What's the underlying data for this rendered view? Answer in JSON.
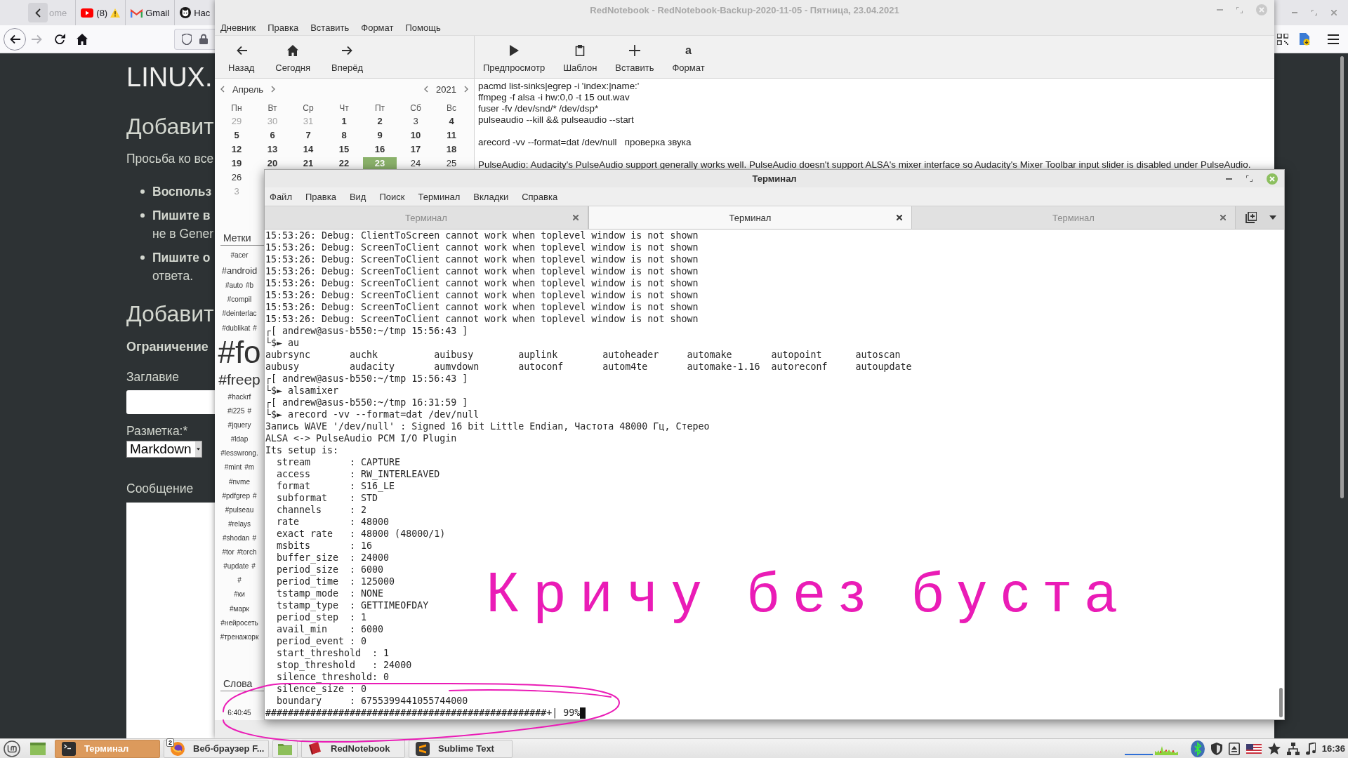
{
  "browser": {
    "tabs": [
      {
        "kind": "plain",
        "label": "ome",
        "alert": false
      },
      {
        "kind": "video",
        "label": "(8)",
        "alert": true
      },
      {
        "kind": "mail",
        "label": "Gmail",
        "alert": false
      },
      {
        "kind": "repo",
        "label": "Нас",
        "alert": false
      }
    ],
    "nav": [
      {
        "kind": "back",
        "disabled": false
      },
      {
        "kind": "forward",
        "disabled": true
      },
      {
        "kind": "reload",
        "disabled": false
      },
      {
        "kind": "home",
        "disabled": false
      }
    ],
    "page": {
      "site_title": "LINUX.",
      "blocks": [
        {
          "kind": "heading",
          "text": "Добавит"
        },
        {
          "kind": "paragraph",
          "text": "Просьба ко все"
        },
        {
          "kind": "bullets",
          "items": [
            {
              "lead": "Воспольз"
            },
            {
              "lead": "Пишите в",
              "rest": "не в Gener"
            },
            {
              "lead": "Пишите о",
              "rest": "ответа."
            }
          ]
        },
        {
          "kind": "heading",
          "text": "Добавит"
        },
        {
          "kind": "subheading",
          "text": "Ограничение"
        },
        {
          "kind": "label",
          "text": "Заглавие"
        },
        {
          "kind": "input"
        },
        {
          "kind": "label",
          "text": "Разметка:*"
        },
        {
          "kind": "select",
          "value": "Markdown"
        },
        {
          "kind": "label",
          "text": "Сообщение"
        },
        {
          "kind": "textarea"
        }
      ]
    }
  },
  "rednotebook": {
    "title": "RedNotebook - RedNotebook-Backup-2020-11-05 - Пятница, 23.04.2021",
    "focused": false,
    "menu": [
      "Дневник",
      "Правка",
      "Вставить",
      "Формат",
      "Помощь"
    ],
    "nav_tools": [
      {
        "kind": "back",
        "label": "Назад"
      },
      {
        "kind": "home",
        "label": "Сегодня"
      },
      {
        "kind": "forward",
        "label": "Вперёд"
      }
    ],
    "edit_tools": [
      {
        "kind": "play",
        "label": "Предпросмотр"
      },
      {
        "kind": "clipboard",
        "label": "Шаблон"
      },
      {
        "kind": "plus",
        "label": "Вставить"
      },
      {
        "kind": "glyph",
        "glyph": "a",
        "label": "Формат"
      }
    ],
    "calendar": {
      "month": "Апрель",
      "year": "2021",
      "weekdays": [
        "Пн",
        "Вт",
        "Ср",
        "Чт",
        "Пт",
        "Сб",
        "Вс"
      ],
      "weeks": [
        [
          {
            "day": "29",
            "other_month": true,
            "has_entry": false,
            "selected": false
          },
          {
            "day": "30",
            "other_month": true,
            "has_entry": false,
            "selected": false
          },
          {
            "day": "31",
            "other_month": true,
            "has_entry": false,
            "selected": false
          },
          {
            "day": "1",
            "other_month": false,
            "has_entry": true,
            "selected": false
          },
          {
            "day": "2",
            "other_month": false,
            "has_entry": true,
            "selected": false
          },
          {
            "day": "3",
            "other_month": false,
            "has_entry": false,
            "selected": false
          },
          {
            "day": "4",
            "other_month": false,
            "has_entry": true,
            "selected": false
          }
        ],
        [
          {
            "day": "5",
            "other_month": false,
            "has_entry": true,
            "selected": false
          },
          {
            "day": "6",
            "other_month": false,
            "has_entry": true,
            "selected": false
          },
          {
            "day": "7",
            "other_month": false,
            "has_entry": true,
            "selected": false
          },
          {
            "day": "8",
            "other_month": false,
            "has_entry": true,
            "selected": false
          },
          {
            "day": "9",
            "other_month": false,
            "has_entry": true,
            "selected": false
          },
          {
            "day": "10",
            "other_month": false,
            "has_entry": true,
            "selected": false
          },
          {
            "day": "11",
            "other_month": false,
            "has_entry": true,
            "selected": false
          }
        ],
        [
          {
            "day": "12",
            "other_month": false,
            "has_entry": true,
            "selected": false
          },
          {
            "day": "13",
            "other_month": false,
            "has_entry": true,
            "selected": false
          },
          {
            "day": "14",
            "other_month": false,
            "has_entry": true,
            "selected": false
          },
          {
            "day": "15",
            "other_month": false,
            "has_entry": true,
            "selected": false
          },
          {
            "day": "16",
            "other_month": false,
            "has_entry": true,
            "selected": false
          },
          {
            "day": "17",
            "other_month": false,
            "has_entry": true,
            "selected": false
          },
          {
            "day": "18",
            "other_month": false,
            "has_entry": true,
            "selected": false
          }
        ],
        [
          {
            "day": "19",
            "other_month": false,
            "has_entry": true,
            "selected": false
          },
          {
            "day": "20",
            "other_month": false,
            "has_entry": true,
            "selected": false
          },
          {
            "day": "21",
            "other_month": false,
            "has_entry": true,
            "selected": false
          },
          {
            "day": "22",
            "other_month": false,
            "has_entry": true,
            "selected": false
          },
          {
            "day": "23",
            "other_month": false,
            "has_entry": true,
            "selected": true
          },
          {
            "day": "24",
            "other_month": false,
            "has_entry": false,
            "selected": false
          },
          {
            "day": "25",
            "other_month": false,
            "has_entry": false,
            "selected": false
          }
        ],
        [
          {
            "day": "26",
            "other_month": false,
            "has_entry": false,
            "selected": false
          }
        ],
        [
          {
            "day": "3",
            "other_month": true,
            "has_entry": false,
            "selected": false
          }
        ]
      ]
    },
    "tags": {
      "title": "Метки",
      "lines": [
        [
          {
            "text": "#acer",
            "kind": "rare"
          }
        ],
        [
          {
            "text": "#android",
            "kind": "common"
          }
        ],
        [
          {
            "text": "#auto",
            "kind": "rare"
          },
          {
            "text": "#b",
            "kind": "rare"
          }
        ],
        [
          {
            "text": "#compil",
            "kind": "rare"
          }
        ],
        [
          {
            "text": "#deinterlac",
            "kind": "rare"
          }
        ],
        [
          {
            "text": "#dublikat",
            "kind": "rare"
          },
          {
            "text": "#",
            "kind": "rare"
          }
        ],
        [
          {
            "text": "#fo",
            "kind": "top"
          }
        ],
        [
          {
            "text": "#freep",
            "kind": "frequent"
          }
        ],
        [
          {
            "text": "#hackrf",
            "kind": "rare"
          }
        ],
        [
          {
            "text": "#i225",
            "kind": "rare"
          },
          {
            "text": "#",
            "kind": "rare"
          }
        ],
        [
          {
            "text": "#jquery",
            "kind": "rare"
          }
        ],
        [
          {
            "text": "#ldap",
            "kind": "rare"
          }
        ],
        [
          {
            "text": "#lesswrong.",
            "kind": "rare"
          }
        ],
        [
          {
            "text": "#mint",
            "kind": "rare"
          },
          {
            "text": "#m",
            "kind": "rare"
          }
        ],
        [
          {
            "text": "#nvme",
            "kind": "rare"
          }
        ],
        [
          {
            "text": "#pdfgrep",
            "kind": "rare"
          },
          {
            "text": "#",
            "kind": "rare"
          }
        ],
        [
          {
            "text": "#pulseau",
            "kind": "rare"
          }
        ],
        [
          {
            "text": "#relays",
            "kind": "rare"
          }
        ],
        [
          {
            "text": "#shodan",
            "kind": "rare"
          },
          {
            "text": "#",
            "kind": "rare"
          }
        ],
        [
          {
            "text": "#tor",
            "kind": "rare"
          },
          {
            "text": "#torch",
            "kind": "rare"
          }
        ],
        [
          {
            "text": "#update",
            "kind": "rare"
          },
          {
            "text": "#",
            "kind": "rare"
          }
        ],
        [
          {
            "text": "#",
            "kind": "rare"
          }
        ],
        [
          {
            "text": "#ки",
            "kind": "rare"
          }
        ],
        [
          {
            "text": "#марк",
            "kind": "rare"
          }
        ],
        [
          {
            "text": "#нейросеть",
            "kind": "rare"
          }
        ],
        [
          {
            "text": "#тренажорк",
            "kind": "rare"
          }
        ]
      ]
    },
    "words": {
      "title": "Слова",
      "items": [
        "6:40:45"
      ]
    },
    "editor": {
      "paragraphs": [
        [
          "pacmd list-sinks|egrep -i 'index:|name:'",
          "ffmpeg -f alsa -i hw:0,0 -t 15 out.wav",
          "fuser -fv /dev/snd/* /dev/dsp*",
          "pulseaudio --kill && pulseaudio --start"
        ],
        [
          "arecord -vv --format=dat /dev/null   проверка звука"
        ],
        [
          "PulseAudio: Audacity's PulseAudio support generally works well. PulseAudio doesn't support ALSA's mixer interface so Audacity's Mixer Toolbar input slider is disabled under PulseAudio."
        ]
      ]
    }
  },
  "terminal": {
    "title": "Терминал",
    "focused": true,
    "menu": [
      "Файл",
      "Правка",
      "Вид",
      "Поиск",
      "Терминал",
      "Вкладки",
      "Справка"
    ],
    "tabs": [
      {
        "label": "Терминал",
        "selected": false
      },
      {
        "label": "Терминал",
        "selected": true
      },
      {
        "label": "Терминал",
        "selected": false
      }
    ],
    "lines": [
      "15:53:26: Debug: ClientToScreen cannot work when toplevel window is not shown",
      "15:53:26: Debug: ScreenToClient cannot work when toplevel window is not shown",
      "15:53:26: Debug: ScreenToClient cannot work when toplevel window is not shown",
      "15:53:26: Debug: ScreenToClient cannot work when toplevel window is not shown",
      "15:53:26: Debug: ScreenToClient cannot work when toplevel window is not shown",
      "15:53:26: Debug: ScreenToClient cannot work when toplevel window is not shown",
      "15:53:26: Debug: ScreenToClient cannot work when toplevel window is not shown",
      "15:53:26: Debug: ScreenToClient cannot work when toplevel window is not shown",
      "┌[ andrew@asus-b550:~/tmp 15:56:43 ]",
      "└$► au",
      "aubrsync       auchk          auibusy        auplink        autoheader     automake       autopoint      autoscan",
      "aubusy         audacity       aumvdown       autoconf       autom4te       automake-1.16  autoreconf     autoupdate",
      "┌[ andrew@asus-b550:~/tmp 15:56:43 ]",
      "└$► alsamixer",
      "┌[ andrew@asus-b550:~/tmp 16:31:59 ]",
      "└$► arecord -vv --format=dat /dev/null",
      "Запись WAVE '/dev/null' : Signed 16 bit Little Endian, Частота 48000 Гц, Стерео",
      "ALSA <-> PulseAudio PCM I/O Plugin",
      "Its setup is:",
      "  stream       : CAPTURE",
      "  access       : RW_INTERLEAVED",
      "  format       : S16_LE",
      "  subformat    : STD",
      "  channels     : 2",
      "  rate         : 48000",
      "  exact rate   : 48000 (48000/1)",
      "  msbits       : 16",
      "  buffer_size  : 24000",
      "  period_size  : 6000",
      "  period_time  : 125000",
      "  tstamp_mode  : NONE",
      "  tstamp_type  : GETTIMEOFDAY",
      "  period_step  : 1",
      "  avail_min    : 6000",
      "  period_event : 0",
      "  start_threshold  : 1",
      "  stop_threshold   : 24000",
      "  silence_threshold: 0",
      "  silence_size : 0",
      "  boundary     : 6755399441055744000",
      "##################################################+| 99%"
    ]
  },
  "taskbar": {
    "tasks": [
      {
        "kind": "terminal",
        "label": "Терминал",
        "selected": true
      },
      {
        "kind": "browser",
        "label": "Веб-браузер F...",
        "badge": "2",
        "selected": false
      },
      {
        "kind": "files",
        "selected": false
      },
      {
        "kind": "notebook",
        "label": "RedNotebook",
        "selected": false
      },
      {
        "kind": "editor",
        "label": "Sublime Text",
        "selected": false
      }
    ],
    "clock": "16:36"
  },
  "annotation": {
    "text": "Кричу без буста"
  }
}
